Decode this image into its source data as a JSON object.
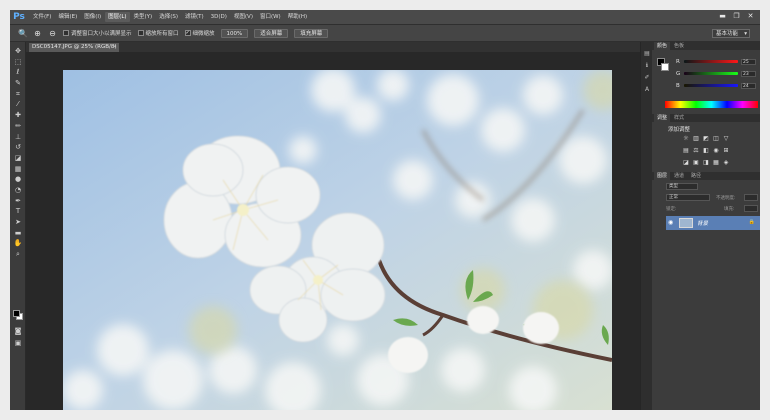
{
  "app": {
    "logo": "Ps"
  },
  "menu": [
    {
      "label": "文件(F)",
      "active": false
    },
    {
      "label": "编辑(E)",
      "active": false
    },
    {
      "label": "图像(I)",
      "active": false
    },
    {
      "label": "图层(L)",
      "active": true
    },
    {
      "label": "类型(Y)",
      "active": false
    },
    {
      "label": "选择(S)",
      "active": false
    },
    {
      "label": "滤镜(T)",
      "active": false
    },
    {
      "label": "3D(D)",
      "active": false
    },
    {
      "label": "视图(V)",
      "active": false
    },
    {
      "label": "窗口(W)",
      "active": false
    },
    {
      "label": "帮助(H)",
      "active": false
    }
  ],
  "window_controls": {
    "minimize": "▬",
    "restore": "❐",
    "close": "✕"
  },
  "options": {
    "checks": [
      {
        "label": "调整窗口大小以满屏显示",
        "checked": false
      },
      {
        "label": "缩放所有窗口",
        "checked": false
      },
      {
        "label": "细微缩放",
        "checked": true
      }
    ],
    "buttons": [
      "100%",
      "适合屏幕",
      "填充屏幕"
    ],
    "workspace": "基本功能"
  },
  "document": {
    "tab_label": "DSC05147.JPG @ 25% (RGB/8)",
    "close": "×"
  },
  "tools": [
    "move-tool",
    "marquee-tool",
    "lasso-tool",
    "quick-select-tool",
    "crop-tool",
    "eyedropper-tool",
    "healing-brush-tool",
    "brush-tool",
    "clone-stamp-tool",
    "history-brush-tool",
    "eraser-tool",
    "gradient-tool",
    "blur-tool",
    "dodge-tool",
    "pen-tool",
    "type-tool",
    "path-select-tool",
    "rectangle-tool",
    "hand-tool",
    "zoom-tool"
  ],
  "panels": {
    "color_tabs": [
      "颜色",
      "色板"
    ],
    "color": {
      "r": {
        "label": "R",
        "value": "25"
      },
      "g": {
        "label": "G",
        "value": "23"
      },
      "b": {
        "label": "B",
        "value": "24"
      }
    },
    "adjust_tabs": [
      "调整",
      "样式"
    ],
    "adjust_title": "添加调整",
    "layers_tabs": [
      "图层",
      "通道",
      "路径"
    ],
    "layer_kind": "类型",
    "layer_mode": "正常",
    "opacity_label": "不透明度:",
    "fill_label": "填充:",
    "lock_label": "锁定:",
    "layer": {
      "name": "背景",
      "lock": "🔒"
    }
  },
  "colors": {
    "accent": "#5a7fb5",
    "menu_bg": "#4a4a4a",
    "canvas_bg": "#282828"
  }
}
